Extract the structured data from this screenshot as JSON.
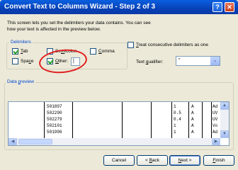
{
  "window": {
    "title": "Convert Text to Columns Wizard - Step 2 of 3",
    "help_glyph": "?",
    "close_glyph": "✕"
  },
  "description": {
    "line1": "This screen lets you set the delimiters your data contains.  You can see",
    "line2": "how your text is affected in the preview below."
  },
  "delimiters": {
    "legend": "Delimiters",
    "items": [
      {
        "name": "tab",
        "pre": "",
        "u": "T",
        "post": "ab",
        "checked": true
      },
      {
        "name": "semicolon",
        "pre": "Se",
        "u": "m",
        "post": "icolon",
        "checked": false
      },
      {
        "name": "comma",
        "pre": "",
        "u": "C",
        "post": "omma",
        "checked": false
      },
      {
        "name": "space",
        "pre": "Spa",
        "u": "c",
        "post": "e",
        "checked": false
      },
      {
        "name": "other",
        "pre": "",
        "u": "O",
        "post": "ther:",
        "checked": true
      }
    ],
    "other_value": "|"
  },
  "options": {
    "consecutive": {
      "pre": "",
      "u": "T",
      "post": "reat consecutive delimiters as one",
      "checked": false
    },
    "qualifier": {
      "pre": "Text ",
      "u": "q",
      "post": "ualifier:",
      "value": "\"",
      "arrow": "⌄"
    }
  },
  "preview": {
    "legend_pre": "Data ",
    "legend_u": "p",
    "legend_post": "review",
    "rows": [
      {
        "id": "501897",
        "v1": "1",
        "v2": "A",
        "v3": "Ad"
      },
      {
        "id": "502290",
        "v1": "0.5",
        "v2": "A",
        "v3": "UV"
      },
      {
        "id": "502279",
        "v1": "0.4",
        "v2": "A",
        "v3": "UV"
      },
      {
        "id": "502101",
        "v1": "1",
        "v2": "A",
        "v3": "Vo"
      },
      {
        "id": "501996",
        "v1": "1",
        "v2": "A",
        "v3": "Ad"
      }
    ],
    "scroll_up": "▲",
    "scroll_down": "▼",
    "scroll_left": "◀",
    "scroll_right": "▶"
  },
  "buttons": {
    "cancel": {
      "pre": "Cancel",
      "u": "",
      "post": ""
    },
    "back": {
      "pre": "< ",
      "u": "B",
      "post": "ack"
    },
    "next": {
      "pre": "",
      "u": "N",
      "post": "ext >"
    },
    "finish": {
      "pre": "",
      "u": "F",
      "post": "inish"
    }
  }
}
